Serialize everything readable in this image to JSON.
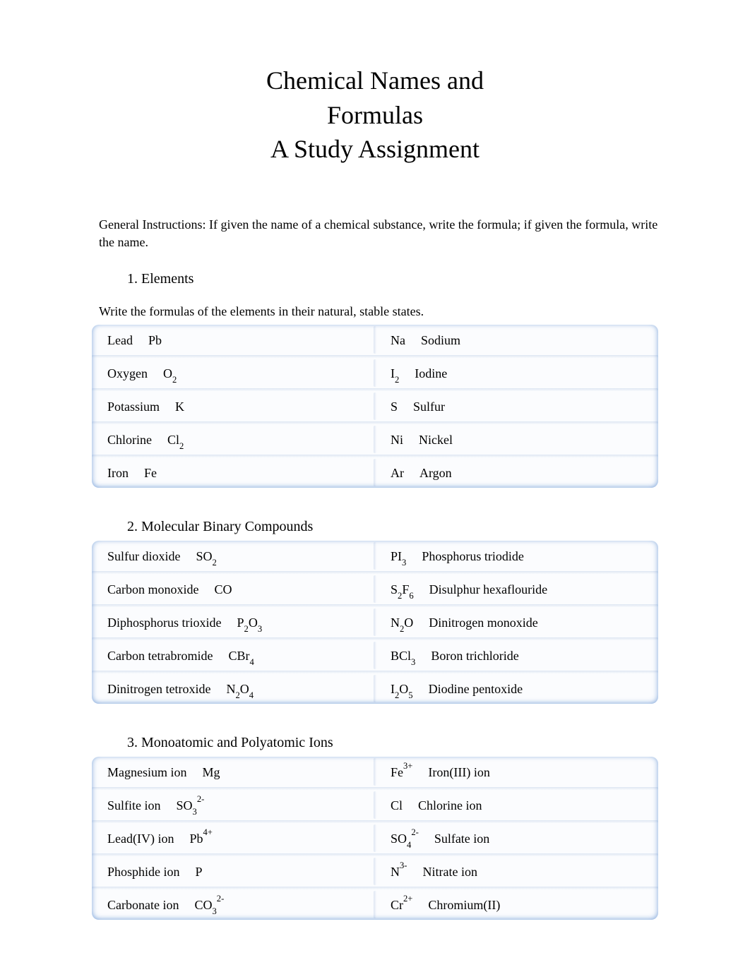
{
  "title_line1": "Chemical Names and",
  "title_line2": "Formulas",
  "title_line3": "A Study Assignment",
  "instructions": "General Instructions: If given the name of a chemical substance, write the formula; if given the formula, write the name.",
  "sections": [
    {
      "heading": "1. Elements",
      "sub_instruction": "Write the formulas of the elements in their natural, stable states.",
      "rows": [
        {
          "left": {
            "prompt": "Lead",
            "answer": "Pb"
          },
          "right": {
            "prompt": "Na",
            "answer": "Sodium"
          }
        },
        {
          "left": {
            "prompt": "Oxygen",
            "answer_html": "O<sub>2</sub>"
          },
          "right": {
            "prompt_html": "I<sub>2</sub>",
            "answer": "Iodine"
          }
        },
        {
          "left": {
            "prompt": "Potassium",
            "answer": "K"
          },
          "right": {
            "prompt": "S",
            "answer": "Sulfur"
          }
        },
        {
          "left": {
            "prompt": "Chlorine",
            "answer_html": "Cl<sub>2</sub>"
          },
          "right": {
            "prompt": "Ni",
            "answer": "Nickel"
          }
        },
        {
          "left": {
            "prompt": "Iron",
            "answer": "Fe"
          },
          "right": {
            "prompt": "Ar",
            "answer": "Argon"
          }
        }
      ]
    },
    {
      "heading": "2. Molecular Binary Compounds",
      "rows": [
        {
          "left": {
            "prompt": "Sulfur dioxide",
            "answer_html": "SO<sub>2</sub>"
          },
          "right": {
            "prompt_html": "PI<sub>3</sub>",
            "answer": "Phosphorus triodide"
          }
        },
        {
          "left": {
            "prompt": "Carbon monoxide",
            "answer": "CO"
          },
          "right": {
            "prompt_html": "S<sub>2</sub>F<sub>6</sub>",
            "answer": "Disulphur hexaflouride"
          }
        },
        {
          "left": {
            "prompt": "Diphosphorus trioxide",
            "answer_html": "P<sub>2</sub>O<sub>3</sub>"
          },
          "right": {
            "prompt_html": "N<sub>2</sub>O",
            "answer": "Dinitrogen monoxide"
          }
        },
        {
          "left": {
            "prompt": "Carbon tetrabromide",
            "answer_html": "CBr<sub>4</sub>"
          },
          "right": {
            "prompt_html": "BCl<sub>3</sub>",
            "answer": "Boron trichloride"
          }
        },
        {
          "left": {
            "prompt": "Dinitrogen tetroxide",
            "answer_html": "N<sub>2</sub>O<sub>4</sub>"
          },
          "right": {
            "prompt_html": "I<sub>2</sub>O<sub>5</sub>",
            "answer": "Diodine pentoxide"
          }
        }
      ]
    },
    {
      "heading": "3. Monoatomic and Polyatomic Ions",
      "rows": [
        {
          "left": {
            "prompt": "Magnesium ion",
            "answer": "Mg"
          },
          "right": {
            "prompt_html": "Fe<sup>3+</sup>",
            "answer": "Iron(III) ion"
          }
        },
        {
          "left": {
            "prompt": "Sulfite ion",
            "answer_html": "SO<sub>3</sub><sup>2-</sup>"
          },
          "right": {
            "prompt": "Cl",
            "answer": "Chlorine ion"
          }
        },
        {
          "left": {
            "prompt": "Lead(IV) ion",
            "answer_html": "Pb<sup>4+</sup>"
          },
          "right": {
            "prompt_html": "SO<sub>4</sub><sup>2-</sup>",
            "answer": "Sulfate ion"
          }
        },
        {
          "left": {
            "prompt": "Phosphide ion",
            "answer": "P"
          },
          "right": {
            "prompt_html": "N<sup>3-</sup>",
            "answer": "Nitrate ion"
          }
        },
        {
          "left": {
            "prompt": "Carbonate ion",
            "answer_html": "CO<sub>3</sub><sup>2-</sup>"
          },
          "right": {
            "prompt_html": "Cr<sup>2+</sup>",
            "answer": "Chromium(II)"
          }
        }
      ]
    }
  ]
}
